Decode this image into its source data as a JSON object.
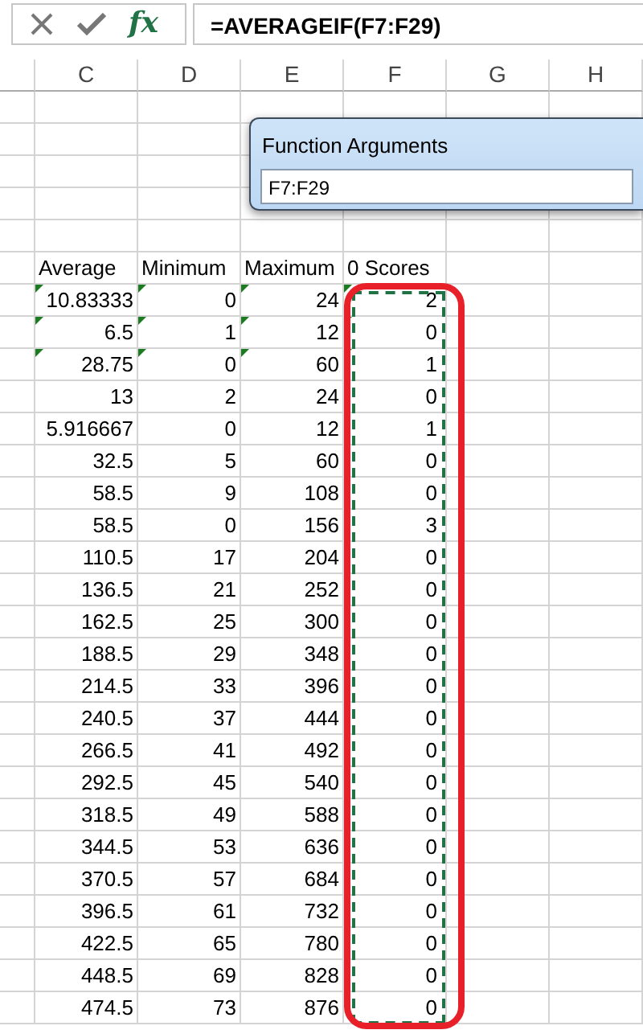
{
  "formula_bar": {
    "fx_label": "fx",
    "formula": "=AVERAGEIF(F7:F29)"
  },
  "column_headers": [
    "C",
    "D",
    "E",
    "F",
    "G",
    "H"
  ],
  "dialog": {
    "title": "Function Arguments",
    "field_value": "F7:F29"
  },
  "table": {
    "columns": [
      "Average",
      "Minimum",
      "Maximum",
      "0 Scores"
    ],
    "rows": [
      {
        "cells": [
          "10.83333",
          "0",
          "24",
          "2"
        ],
        "flagged": true
      },
      {
        "cells": [
          "6.5",
          "1",
          "12",
          "0"
        ],
        "flagged": true
      },
      {
        "cells": [
          "28.75",
          "0",
          "60",
          "1"
        ],
        "flagged": true
      },
      {
        "cells": [
          "13",
          "2",
          "24",
          "0"
        ],
        "flagged": false
      },
      {
        "cells": [
          "5.916667",
          "0",
          "12",
          "1"
        ],
        "flagged": false
      },
      {
        "cells": [
          "32.5",
          "5",
          "60",
          "0"
        ],
        "flagged": false
      },
      {
        "cells": [
          "58.5",
          "9",
          "108",
          "0"
        ],
        "flagged": false
      },
      {
        "cells": [
          "58.5",
          "0",
          "156",
          "3"
        ],
        "flagged": false
      },
      {
        "cells": [
          "110.5",
          "17",
          "204",
          "0"
        ],
        "flagged": false
      },
      {
        "cells": [
          "136.5",
          "21",
          "252",
          "0"
        ],
        "flagged": false
      },
      {
        "cells": [
          "162.5",
          "25",
          "300",
          "0"
        ],
        "flagged": false
      },
      {
        "cells": [
          "188.5",
          "29",
          "348",
          "0"
        ],
        "flagged": false
      },
      {
        "cells": [
          "214.5",
          "33",
          "396",
          "0"
        ],
        "flagged": false
      },
      {
        "cells": [
          "240.5",
          "37",
          "444",
          "0"
        ],
        "flagged": false
      },
      {
        "cells": [
          "266.5",
          "41",
          "492",
          "0"
        ],
        "flagged": false
      },
      {
        "cells": [
          "292.5",
          "45",
          "540",
          "0"
        ],
        "flagged": false
      },
      {
        "cells": [
          "318.5",
          "49",
          "588",
          "0"
        ],
        "flagged": false
      },
      {
        "cells": [
          "344.5",
          "53",
          "636",
          "0"
        ],
        "flagged": false
      },
      {
        "cells": [
          "370.5",
          "57",
          "684",
          "0"
        ],
        "flagged": false
      },
      {
        "cells": [
          "396.5",
          "61",
          "732",
          "0"
        ],
        "flagged": false
      },
      {
        "cells": [
          "422.5",
          "65",
          "780",
          "0"
        ],
        "flagged": false
      },
      {
        "cells": [
          "448.5",
          "69",
          "828",
          "0"
        ],
        "flagged": false
      },
      {
        "cells": [
          "474.5",
          "73",
          "876",
          "0"
        ],
        "flagged": false
      }
    ]
  }
}
